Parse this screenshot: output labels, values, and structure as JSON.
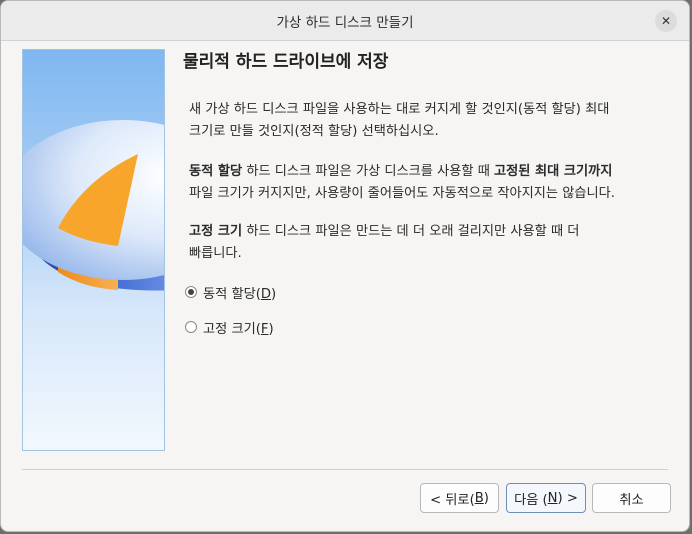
{
  "window": {
    "title": "가상 하드 디스크 만들기"
  },
  "page": {
    "heading": "물리적 하드 드라이브에 저장",
    "intro_line1": "새 가상 하드 디스크 파일을 사용하는 대로 커지게 할 것인지(동적 할당) 최대",
    "intro_line2": "크기로 만들 것인지(정적 할당) 선택하십시오.",
    "dynamic_bold": "동적 할당",
    "dynamic_text1": " 하드 디스크 파일은 가상 디스크를 사용할 때 ",
    "dynamic_bold2": "고정된 최대 크기까지",
    "dynamic_line2": "파일 크기가 커지지만, 사용량이 줄어들어도 자동적으로 작아지지는 않습니다.",
    "fixed_bold": "고정 크기",
    "fixed_text1": " 하드 디스크 파일은 만드는 데 더 오래 걸리지만 사용할 때 더",
    "fixed_line2": "빠릅니다."
  },
  "options": {
    "dynamic": {
      "label": "동적 할당(",
      "mnemonic": "D",
      "suffix": ")",
      "selected": true
    },
    "fixed": {
      "label": "고정 크기(",
      "mnemonic": "F",
      "suffix": ")",
      "selected": false
    }
  },
  "buttons": {
    "back_prefix": "< 뒤로(",
    "back_mnemonic": "B",
    "back_suffix": ")",
    "next_prefix": "다음 (",
    "next_mnemonic": "N",
    "next_suffix": ") >",
    "cancel": "취소"
  },
  "icons": {
    "close": "close-icon",
    "watermark": "disk-pie-icon"
  },
  "colors": {
    "accent": "#6d8fb5",
    "disk_blue": "#3b5fc0",
    "slice_orange": "#f5a623"
  }
}
